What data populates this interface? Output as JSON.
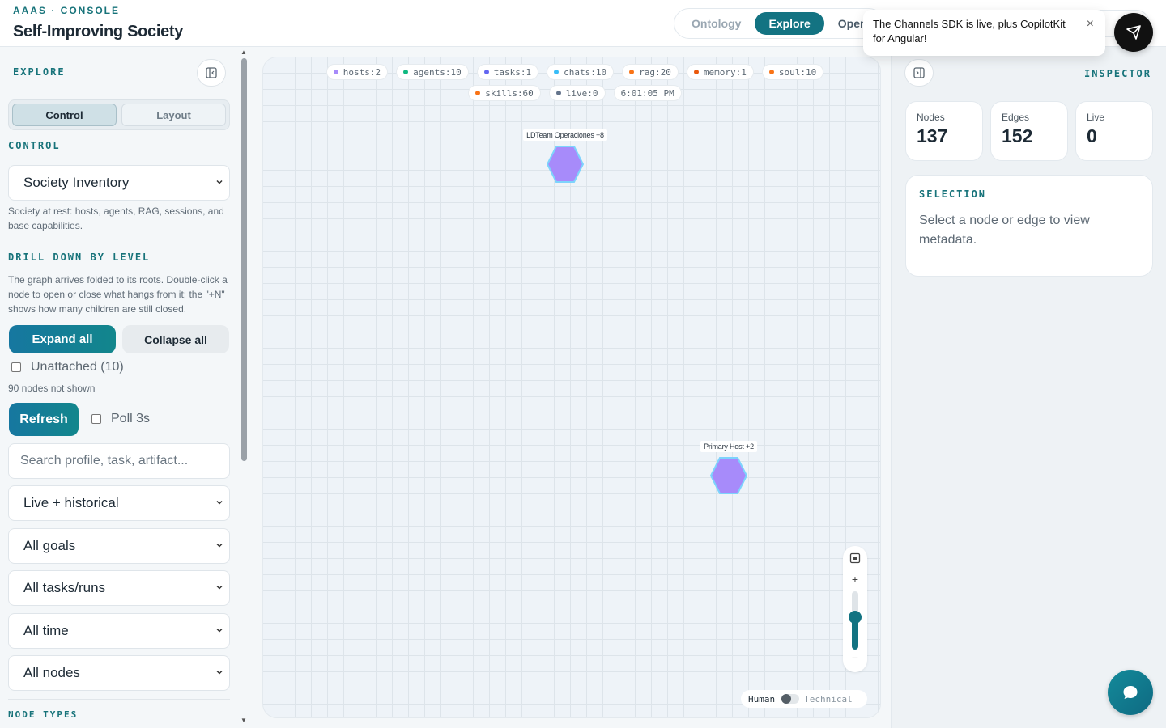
{
  "app": {
    "kicker": "AAAS · CONSOLE",
    "title": "Self-Improving Society"
  },
  "nav": {
    "tabs": [
      {
        "label": "Ontology"
      },
      {
        "label": "Explore"
      },
      {
        "label": "Oper"
      }
    ]
  },
  "toast": {
    "message": "The Channels SDK is live, plus CopilotKit for Angular!",
    "close": "×"
  },
  "sidebar": {
    "section_explore": "EXPLORE",
    "segments": [
      "Control",
      "Layout"
    ],
    "section_control": "CONTROL",
    "control_select": "Society Inventory",
    "control_help": "Society at rest: hosts, agents, RAG, sessions, and base capabilities.",
    "section_drill": "DRILL DOWN BY LEVEL",
    "drill_help": "The graph arrives folded to its roots. Double-click a node to open or close what hangs from it; the \"+N\" shows how many children are still closed.",
    "expand_all": "Expand all",
    "collapse_all": "Collapse all",
    "unattached": "Unattached (10)",
    "hidden_note": "90 nodes not shown",
    "refresh": "Refresh",
    "poll": "Poll 3s",
    "search_placeholder": "Search profile, task, artifact...",
    "filters": [
      "Live + historical",
      "All goals",
      "All tasks/runs",
      "All time",
      "All nodes"
    ],
    "section_node_types": "NODE TYPES"
  },
  "canvas": {
    "counters": [
      {
        "label": "hosts:2",
        "color": "#a78bfa"
      },
      {
        "label": "agents:10",
        "color": "#10b981"
      },
      {
        "label": "tasks:1",
        "color": "#6366f1"
      },
      {
        "label": "chats:10",
        "color": "#38bdf8"
      },
      {
        "label": "rag:20",
        "color": "#f97316"
      },
      {
        "label": "memory:1",
        "color": "#ea580c"
      },
      {
        "label": "soul:10",
        "color": "#f97316"
      },
      {
        "label": "skills:60",
        "color": "#f97316"
      },
      {
        "label": "live:0",
        "color": "#64748b"
      },
      {
        "label": "6:01:05 PM",
        "color": ""
      }
    ],
    "nodes": [
      {
        "label": "LDTeam Operaciones",
        "badge": "+8",
        "color": "#a78bfa"
      },
      {
        "label": "Primary Host",
        "badge": "+2",
        "color": "#a78bfa"
      }
    ],
    "zoom": {
      "plus": "+",
      "minus": "−",
      "level": 0.55
    },
    "mode": {
      "human": "Human",
      "technical": "Technical"
    }
  },
  "inspector": {
    "title": "INSPECTOR",
    "stats": [
      {
        "label": "Nodes",
        "value": "137"
      },
      {
        "label": "Edges",
        "value": "152"
      },
      {
        "label": "Live",
        "value": "0"
      }
    ],
    "selection_title": "SELECTION",
    "selection_text": "Select a node or edge to view metadata."
  },
  "colors": {
    "accent": "#137382",
    "node_fill": "#a78bfa",
    "node_stroke": "#7dd3fc"
  }
}
